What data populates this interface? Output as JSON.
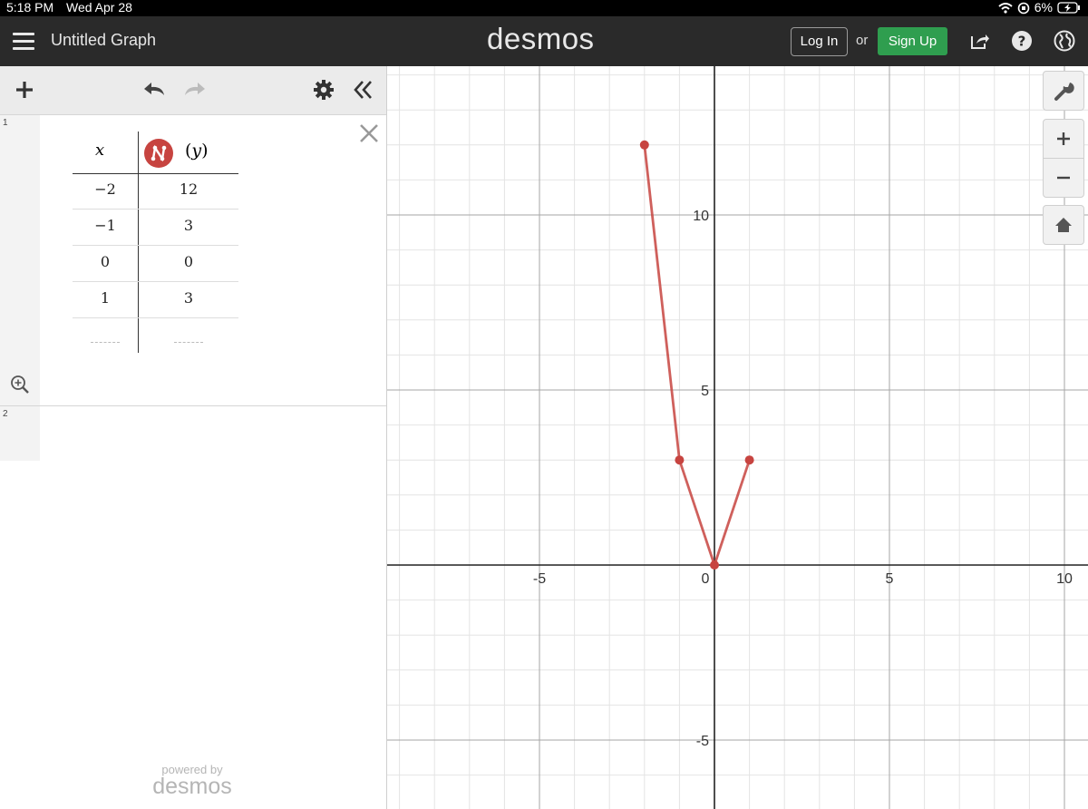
{
  "status_bar": {
    "time": "5:18 PM",
    "date": "Wed Apr 28",
    "battery": "6%",
    "icons": [
      "wifi-icon",
      "orientation-lock-icon",
      "battery-charging-icon"
    ]
  },
  "header": {
    "title": "Untitled Graph",
    "logo": "desmos",
    "login_label": "Log In",
    "or_label": "or",
    "signup_label": "Sign Up",
    "icons": [
      "menu-icon",
      "share-icon",
      "help-icon",
      "language-globe-icon"
    ],
    "signup_color": "#2f9e4f"
  },
  "expression_list": {
    "toolbar_icons": [
      "add-icon",
      "undo-icon",
      "redo-icon",
      "settings-gear-icon",
      "collapse-panel-icon"
    ],
    "rows": [
      {
        "number": "1",
        "type": "table",
        "columns": [
          "x",
          "y"
        ],
        "rows": [
          [
            "−2",
            "12"
          ],
          [
            "−1",
            "3"
          ],
          [
            "0",
            "0"
          ],
          [
            "1",
            "3"
          ]
        ],
        "series_color": "#c74440"
      },
      {
        "number": "2",
        "type": "empty"
      }
    ],
    "powered_by": "powered by",
    "powered_logo": "desmos"
  },
  "graph": {
    "x_ticks": [
      "-5",
      "0",
      "5",
      "10"
    ],
    "y_ticks": [
      "10",
      "5",
      "-5"
    ],
    "side_buttons": [
      "wrench-icon",
      "zoom-in-icon",
      "zoom-out-icon",
      "home-icon"
    ]
  },
  "chart_data": {
    "type": "line",
    "x": [
      -2,
      -1,
      0,
      1
    ],
    "series": [
      {
        "values": [
          12,
          3,
          0,
          3
        ]
      }
    ],
    "xlim": [
      -9.4,
      10.8
    ],
    "ylim": [
      -7,
      14.1
    ],
    "grid": true,
    "colors": [
      "#c74440"
    ]
  }
}
